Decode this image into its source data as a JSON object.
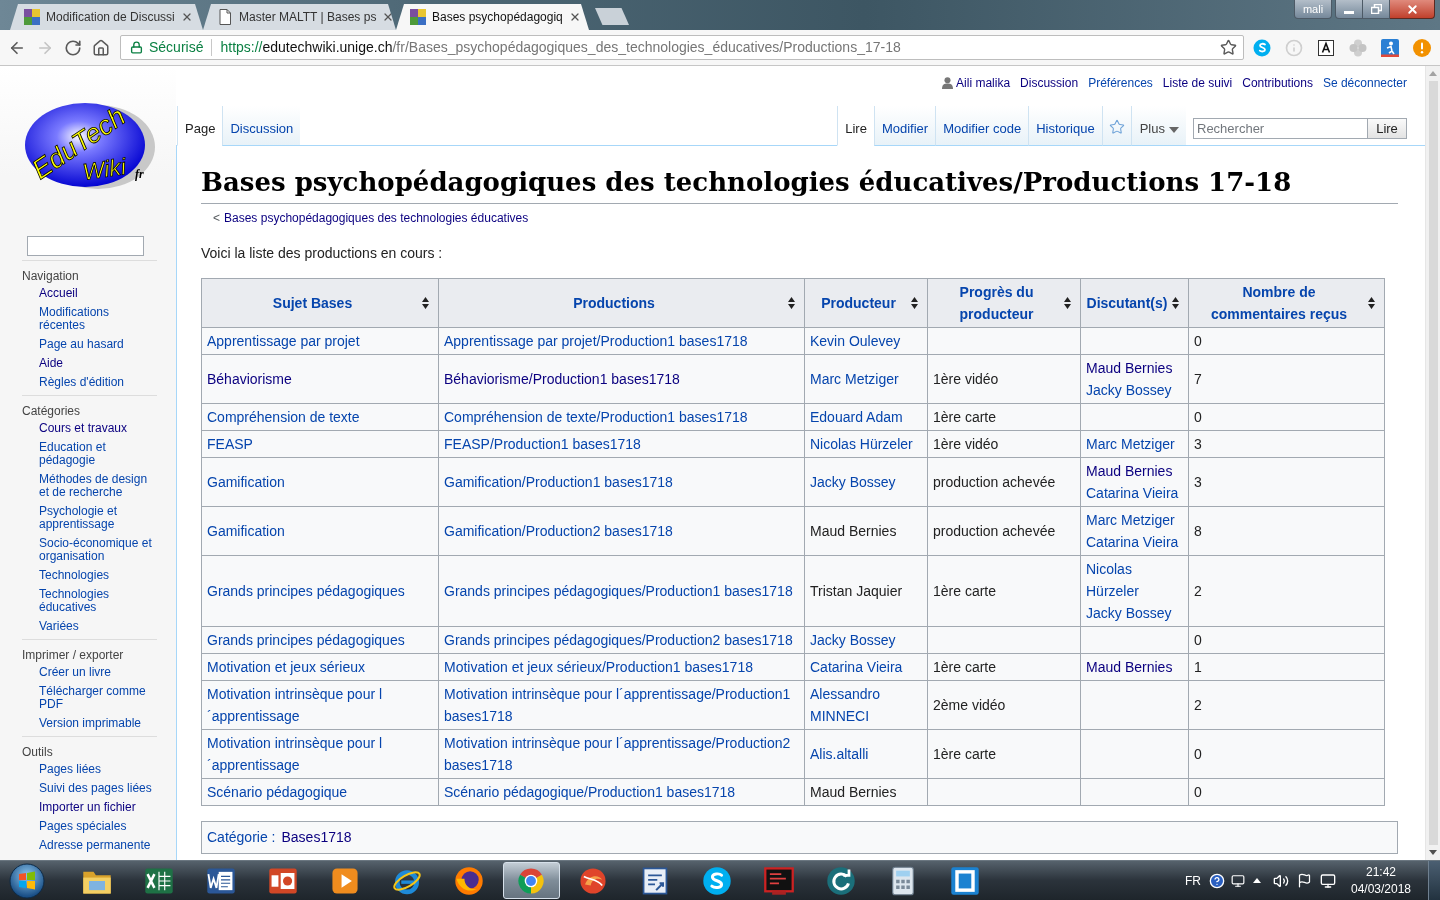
{
  "browser": {
    "tabs": [
      {
        "title": "Modification de Discussi",
        "kind": "wiki",
        "selected": false
      },
      {
        "title": "Master MALTT | Bases ps",
        "kind": "page",
        "selected": false
      },
      {
        "title": "Bases psychopédagogiq",
        "kind": "wiki",
        "selected": true
      }
    ],
    "profile": "mali",
    "forward_disabled": true,
    "secure_label": "Sécurisé",
    "url": {
      "scheme": "https://",
      "host": "edutechwiki.unige.ch",
      "path": "/fr/Bases_psychopédagogiques_des_technologies_éducatives/Productions_17-18"
    }
  },
  "user_links": [
    {
      "label": "Aili malika",
      "visited": true
    },
    {
      "label": "Discussion",
      "visited": true
    },
    {
      "label": "Préférences",
      "visited": false
    },
    {
      "label": "Liste de suivi",
      "visited": true
    },
    {
      "label": "Contributions",
      "visited": true
    },
    {
      "label": "Se déconnecter",
      "visited": false
    }
  ],
  "page_tabs": {
    "namespaces": [
      {
        "label": "Page",
        "selected": true
      },
      {
        "label": "Discussion",
        "selected": false
      }
    ],
    "views": [
      {
        "label": "Lire",
        "selected": true
      },
      {
        "label": "Modifier",
        "selected": false
      },
      {
        "label": "Modifier code",
        "selected": false
      },
      {
        "label": "Historique",
        "selected": false
      }
    ],
    "more": "Plus",
    "search": {
      "placeholder": "Rechercher",
      "button": "Lire"
    }
  },
  "sidebar": {
    "logo": {
      "name": "EduTech",
      "sub": "Wiki",
      "lang": "fr"
    },
    "sections": [
      {
        "heading": "Navigation",
        "items": [
          {
            "label": "Accueil",
            "visited": true
          },
          {
            "label": "Modifications récentes",
            "visited": false
          },
          {
            "label": "Page au hasard",
            "visited": false
          },
          {
            "label": "Aide",
            "visited": true
          },
          {
            "label": "Règles d'édition",
            "visited": false
          }
        ]
      },
      {
        "heading": "Catégories",
        "items": [
          {
            "label": "Cours et travaux",
            "visited": true
          },
          {
            "label": "Education et pédagogie",
            "visited": false
          },
          {
            "label": "Méthodes de design et de recherche",
            "visited": false
          },
          {
            "label": "Psychologie et apprentissage",
            "visited": false
          },
          {
            "label": "Socio-économique et organisation",
            "visited": false
          },
          {
            "label": "Technologies",
            "visited": false
          },
          {
            "label": "Technologies éducatives",
            "visited": false
          },
          {
            "label": "Variées",
            "visited": false
          }
        ]
      },
      {
        "heading": "Imprimer / exporter",
        "items": [
          {
            "label": "Créer un livre",
            "visited": false
          },
          {
            "label": "Télécharger comme PDF",
            "visited": false
          },
          {
            "label": "Version imprimable",
            "visited": false
          }
        ]
      },
      {
        "heading": "Outils",
        "items": [
          {
            "label": "Pages liées",
            "visited": false
          },
          {
            "label": "Suivi des pages liées",
            "visited": false
          },
          {
            "label": "Importer un fichier",
            "visited": true
          },
          {
            "label": "Pages spéciales",
            "visited": false
          },
          {
            "label": "Adresse permanente",
            "visited": false
          }
        ]
      }
    ]
  },
  "article": {
    "title": "Bases psychopédagogiques des technologies éducatives/Productions 17-18",
    "breadcrumb": {
      "prefix": "<",
      "link": "Bases psychopédagogiques des technologies éducatives",
      "visited": true
    },
    "intro": "Voici la liste des productions en cours :",
    "table": {
      "columns": [
        "Sujet Bases",
        "Productions",
        "Producteur",
        "Progrès du producteur",
        "Discutant(s)",
        "Nombre de commentaires reçus"
      ],
      "rows": [
        {
          "subject": {
            "text": "Apprentissage par projet",
            "kind": "link"
          },
          "production": {
            "text": "Apprentissage par projet/Production1 bases1718",
            "kind": "link"
          },
          "producer": {
            "text": "Kevin Oulevey",
            "kind": "link"
          },
          "comments": "0"
        },
        {
          "subject": {
            "text": "Béhaviorisme",
            "kind": "visited"
          },
          "production": {
            "text": "Béhaviorisme/Production1 bases1718",
            "kind": "visited"
          },
          "producer": {
            "text": "Marc Metziger",
            "kind": "link"
          },
          "progress": "1ère vidéo",
          "discussants": [
            {
              "text": "Maud Bernies",
              "kind": "visited"
            },
            {
              "text": "Jacky Bossey",
              "kind": "link"
            }
          ],
          "comments": "7"
        },
        {
          "subject": {
            "text": "Compréhension de texte",
            "kind": "link"
          },
          "production": {
            "text": "Compréhension de texte/Production1 bases1718",
            "kind": "link"
          },
          "producer": {
            "text": "Edouard Adam",
            "kind": "link"
          },
          "progress": "1ère carte",
          "comments": "0"
        },
        {
          "subject": {
            "text": "FEASP",
            "kind": "link"
          },
          "production": {
            "text": "FEASP/Production1 bases1718",
            "kind": "link"
          },
          "producer": {
            "text": "Nicolas Hürzeler",
            "kind": "link"
          },
          "progress": "1ère vidéo",
          "discussants": [
            {
              "text": "Marc Metziger",
              "kind": "link"
            }
          ],
          "comments": "3"
        },
        {
          "subject": {
            "text": "Gamification",
            "kind": "link"
          },
          "production": {
            "text": "Gamification/Production1 bases1718",
            "kind": "link"
          },
          "producer": {
            "text": "Jacky Bossey",
            "kind": "link"
          },
          "progress": "production achevée",
          "discussants": [
            {
              "text": "Maud Bernies",
              "kind": "visited"
            },
            {
              "text": "Catarina Vieira",
              "kind": "link"
            }
          ],
          "comments": "3"
        },
        {
          "subject": {
            "text": "Gamification",
            "kind": "link"
          },
          "production": {
            "text": "Gamification/Production2 bases1718",
            "kind": "link"
          },
          "producer": {
            "text": "Maud Bernies",
            "kind": "text"
          },
          "progress": "production achevée",
          "discussants": [
            {
              "text": "Marc Metziger",
              "kind": "link"
            },
            {
              "text": "Catarina Vieira",
              "kind": "link"
            }
          ],
          "comments": "8"
        },
        {
          "subject": {
            "text": "Grands principes pédagogiques",
            "kind": "link"
          },
          "production": {
            "text": "Grands principes pédagogiques/Production1 bases1718",
            "kind": "link"
          },
          "producer": {
            "text": "Tristan Jaquier",
            "kind": "text"
          },
          "progress": "1ère carte",
          "discussants": [
            {
              "text": "Nicolas Hürzeler",
              "kind": "link"
            },
            {
              "text": "Jacky Bossey",
              "kind": "link"
            }
          ],
          "comments": "2"
        },
        {
          "subject": {
            "text": "Grands principes pédagogiques",
            "kind": "link"
          },
          "production": {
            "text": "Grands principes pédagogiques/Production2 bases1718",
            "kind": "link"
          },
          "producer": {
            "text": "Jacky Bossey",
            "kind": "link"
          },
          "comments": "0"
        },
        {
          "subject": {
            "text": "Motivation et jeux sérieux",
            "kind": "link"
          },
          "production": {
            "text": "Motivation et jeux sérieux/Production1 bases1718",
            "kind": "link"
          },
          "producer": {
            "text": "Catarina Vieira",
            "kind": "link"
          },
          "progress": "1ère carte",
          "discussants": [
            {
              "text": "Maud Bernies",
              "kind": "visited"
            }
          ],
          "comments": "1"
        },
        {
          "subject": {
            "text": "Motivation intrinsèque pour l´apprentissage",
            "kind": "link"
          },
          "production": {
            "text": "Motivation intrinsèque pour l´apprentissage/Production1 bases1718",
            "kind": "link"
          },
          "producer": {
            "text": "Alessandro MINNECI",
            "kind": "link"
          },
          "progress": "2ème vidéo",
          "comments": "2"
        },
        {
          "subject": {
            "text": "Motivation intrinsèque pour l´apprentissage",
            "kind": "link"
          },
          "production": {
            "text": "Motivation intrinsèque pour l´apprentissage/Production2 bases1718",
            "kind": "link"
          },
          "producer": {
            "text": "Alis.altalli",
            "kind": "link"
          },
          "progress": "1ère carte",
          "comments": "0"
        },
        {
          "subject": {
            "text": "Scénario pédagogique",
            "kind": "link"
          },
          "production": {
            "text": "Scénario pédagogique/Production1 bases1718",
            "kind": "link"
          },
          "producer": {
            "text": "Maud Bernies",
            "kind": "text"
          },
          "comments": "0"
        }
      ]
    },
    "categories": {
      "label": "Catégorie :",
      "items": [
        {
          "label": "Bases1718",
          "visited": true
        }
      ]
    }
  },
  "taskbar": {
    "apps": [
      {
        "kind": "folder",
        "selected": false
      },
      {
        "kind": "spreadsheet",
        "selected": false
      },
      {
        "kind": "document",
        "selected": false
      },
      {
        "kind": "slides",
        "selected": false
      },
      {
        "kind": "player",
        "selected": false
      },
      {
        "kind": "globe",
        "selected": false
      },
      {
        "kind": "flame",
        "selected": false
      },
      {
        "kind": "wheel",
        "selected": true
      },
      {
        "kind": "swirl",
        "selected": false
      },
      {
        "kind": "note",
        "selected": false
      },
      {
        "kind": "chat",
        "selected": false
      },
      {
        "kind": "terminal",
        "selected": false
      },
      {
        "kind": "sync",
        "selected": false
      },
      {
        "kind": "calculator",
        "selected": false
      },
      {
        "kind": "frame",
        "selected": false
      }
    ],
    "language": "FR",
    "time": "21:42",
    "date": "04/03/2018"
  }
}
